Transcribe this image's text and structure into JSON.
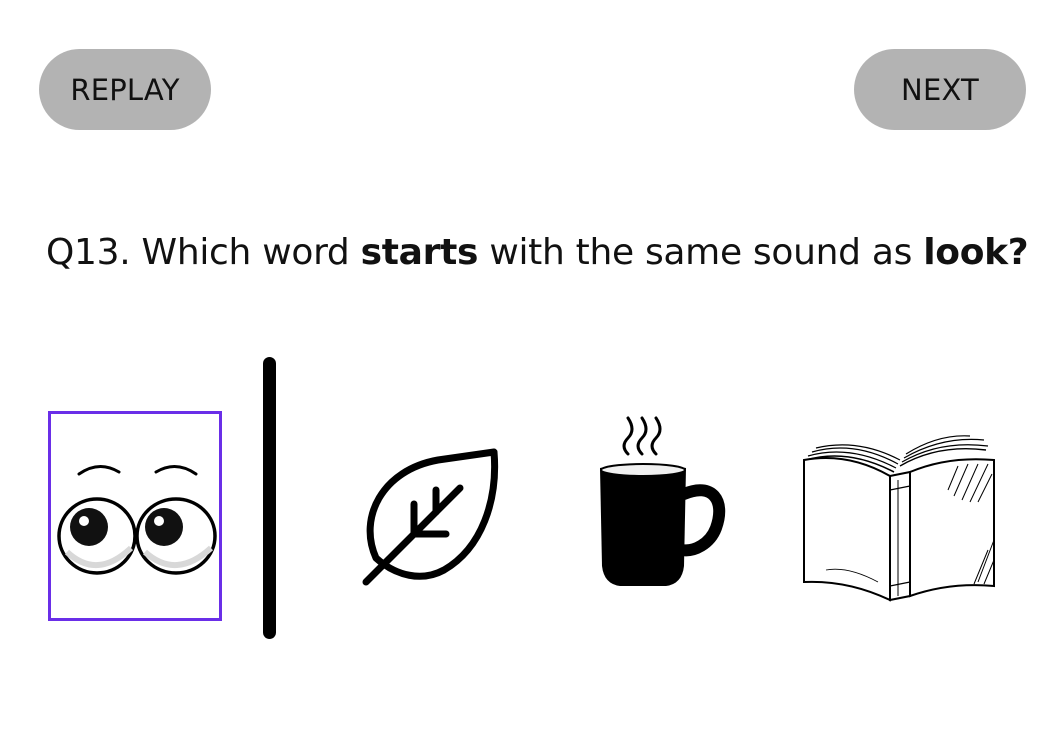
{
  "toolbar": {
    "replay_label": "REPLAY",
    "next_label": "NEXT"
  },
  "question": {
    "prefix": "Q13. Which word ",
    "emphasis_1": "starts",
    "middle": " with the same sound as ",
    "emphasis_2": "look?"
  },
  "target": {
    "icon": "eyes-icon",
    "selection_color": "#6a2ee8"
  },
  "choices": [
    {
      "icon": "leaf-icon"
    },
    {
      "icon": "mug-icon"
    },
    {
      "icon": "book-icon"
    }
  ],
  "colors": {
    "button_bg": "#b3b3b3",
    "text": "#111111",
    "accent": "#6a2ee8"
  }
}
